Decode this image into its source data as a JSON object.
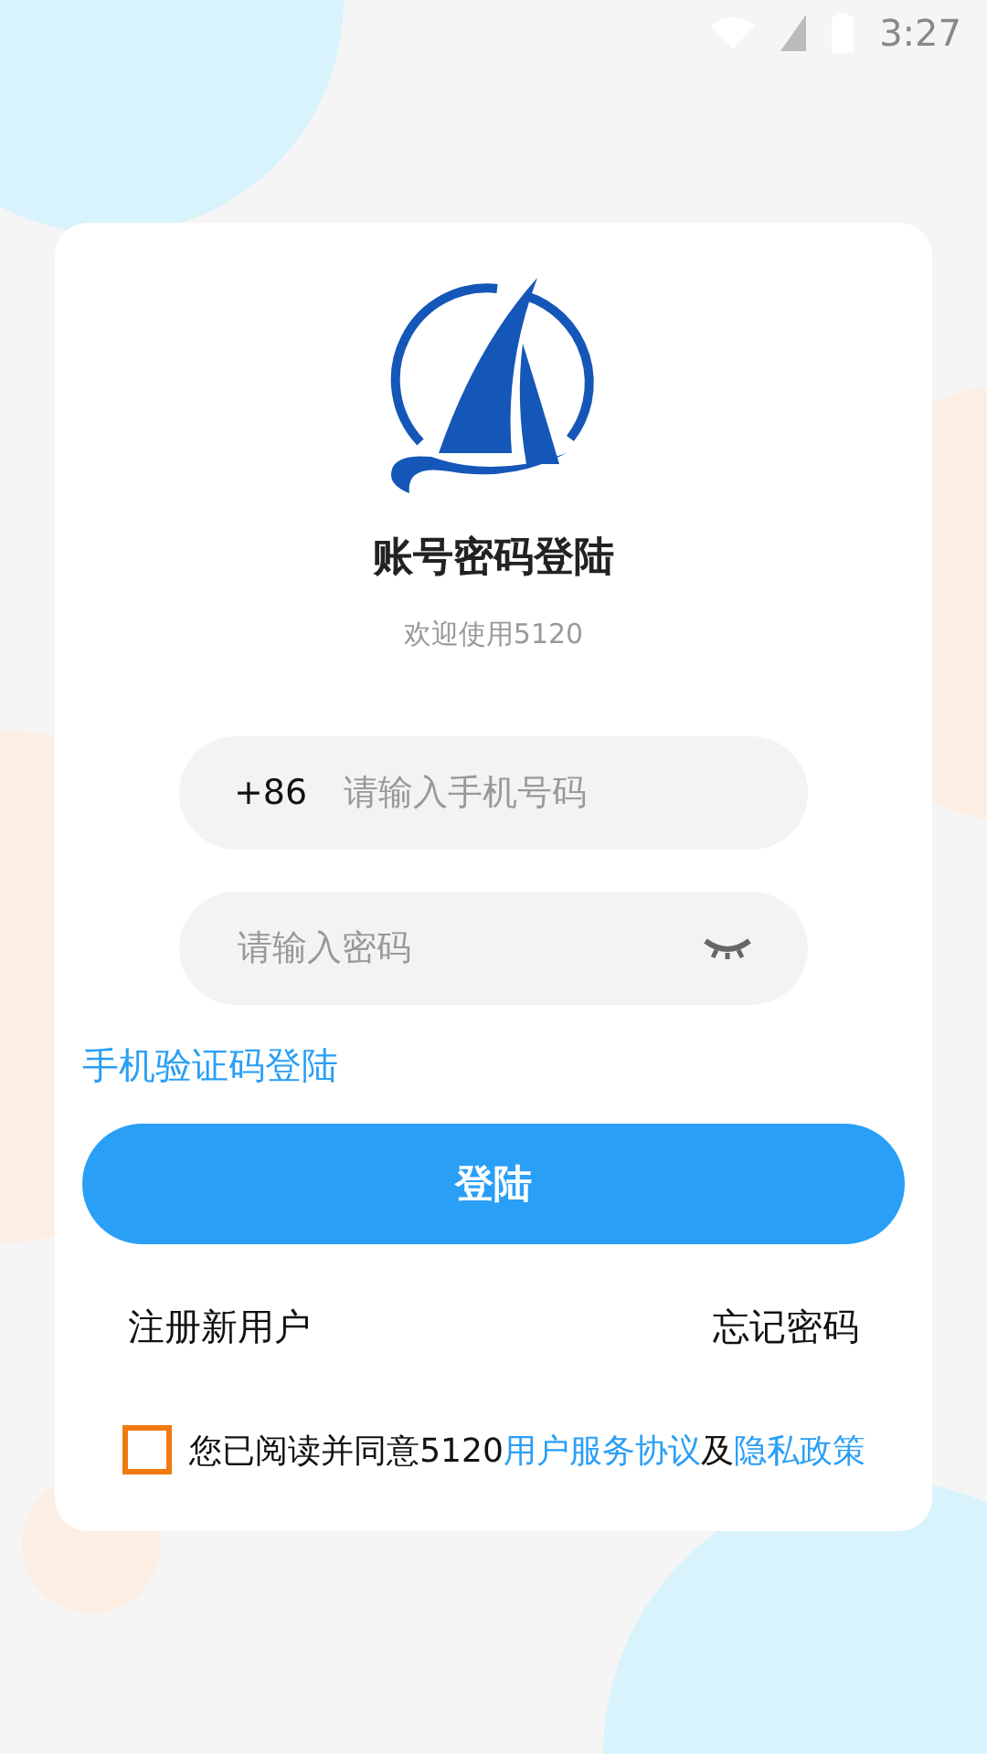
{
  "status_bar": {
    "time": "3:27"
  },
  "header": {
    "title": "账号密码登陆",
    "subtitle": "欢迎使用5120"
  },
  "phone_field": {
    "prefix": "+86",
    "placeholder": "请输入手机号码"
  },
  "password_field": {
    "placeholder": "请输入密码"
  },
  "sms_login_link": "手机验证码登陆",
  "login_button": "登陆",
  "links": [
    "注册新用户",
    "忘记密码"
  ],
  "agreement": {
    "checked": false,
    "text": "您已阅读并同意5120",
    "terms_link": "用户服务协议",
    "joiner": "及",
    "privacy_link": "隐私政策"
  }
}
